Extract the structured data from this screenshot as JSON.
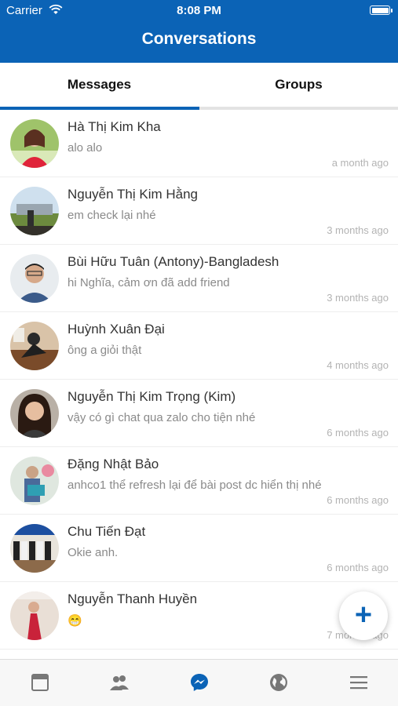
{
  "status_bar": {
    "carrier": "Carrier",
    "time": "8:08 PM"
  },
  "header": {
    "title": "Conversations"
  },
  "tabs": [
    {
      "label": "Messages",
      "active": true
    },
    {
      "label": "Groups",
      "active": false
    }
  ],
  "conversations": [
    {
      "name": "Hà Thị Kim Kha",
      "message": "alo alo",
      "time": "a month ago"
    },
    {
      "name": "Nguyễn Thị Kim Hằng",
      "message": "em check lại nhé",
      "time": "3 months ago"
    },
    {
      "name": "Bùi Hữu Tuân (Antony)-Bangladesh",
      "message": "hi Nghĩa, cảm ơn đã add friend",
      "time": "3 months ago"
    },
    {
      "name": "Huỳnh Xuân Đại",
      "message": "ông a giỏi thật",
      "time": "4 months ago"
    },
    {
      "name": "Nguyễn Thị Kim Trọng (Kim)",
      "message": "vậy có gì chat qua zalo cho tiện nhé",
      "time": "6 months ago"
    },
    {
      "name": "Đặng Nhật Bảo",
      "message": "anhco1 thể refresh lại để bài post dc hiển thị nhé",
      "time": "6 months ago"
    },
    {
      "name": "Chu Tiến Đạt",
      "message": "Okie anh.",
      "time": "6 months ago"
    },
    {
      "name": "Nguyễn Thanh Huyền",
      "message": "😁",
      "time": "7 months ago"
    }
  ],
  "fab": {
    "label": "+"
  },
  "bottom_nav": [
    {
      "icon": "news-feed-icon",
      "active": false
    },
    {
      "icon": "friends-icon",
      "active": false
    },
    {
      "icon": "messenger-icon",
      "active": true
    },
    {
      "icon": "globe-icon",
      "active": false
    },
    {
      "icon": "menu-icon",
      "active": false
    }
  ],
  "colors": {
    "primary": "#0b63b6",
    "tab_underline": "#0b63b6",
    "inactive_icon": "#777777"
  }
}
